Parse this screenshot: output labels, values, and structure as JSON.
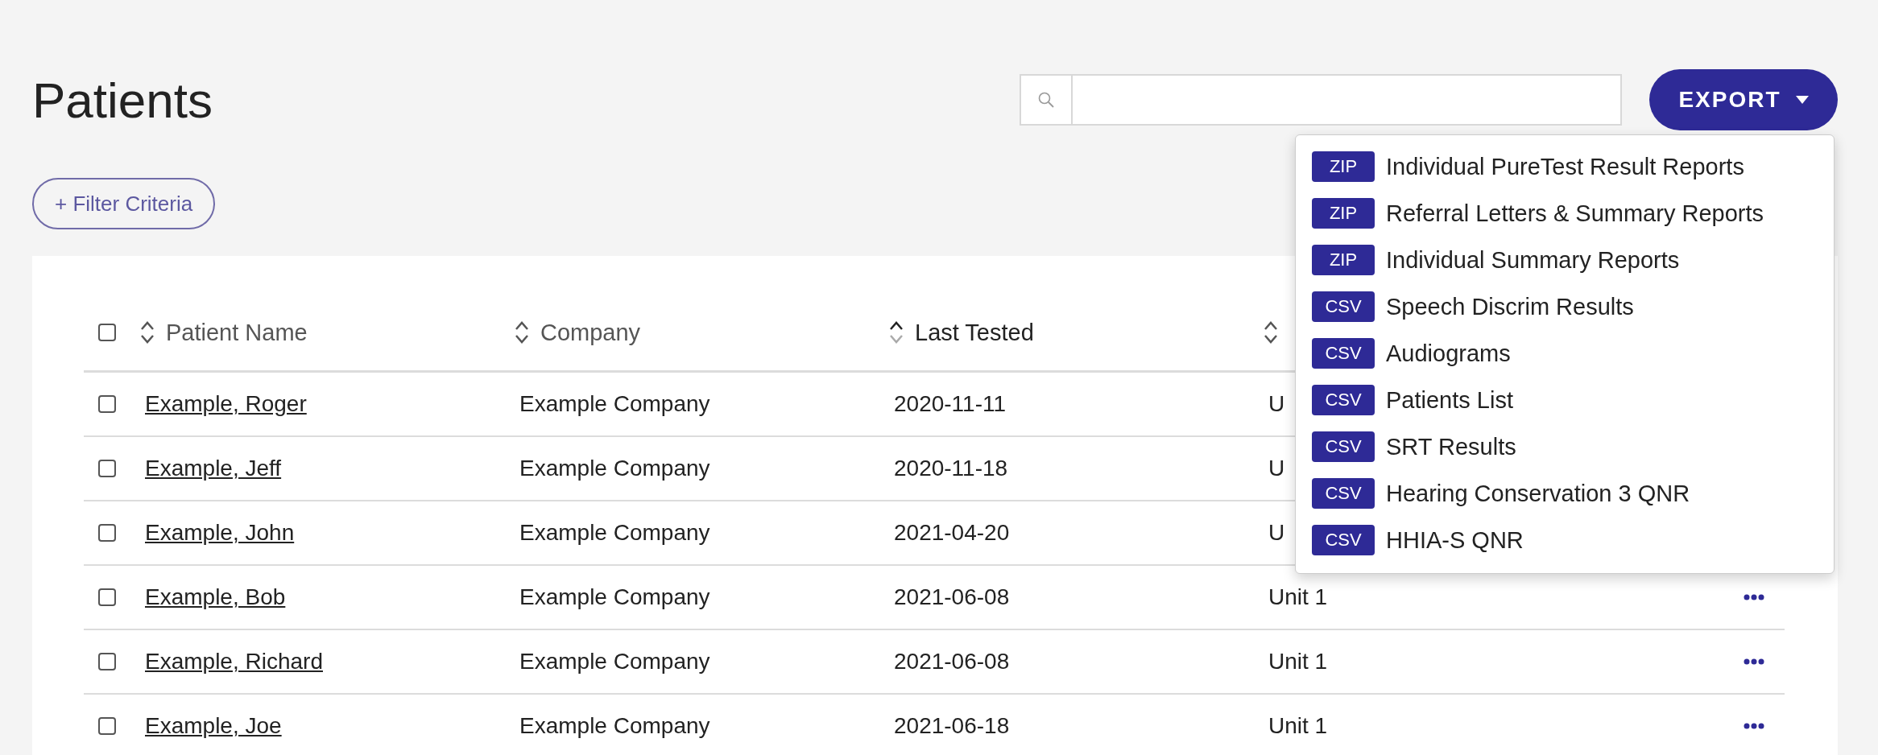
{
  "page": {
    "title": "Patients"
  },
  "export_button": {
    "label": "EXPORT",
    "expanded": true
  },
  "export_menu": [
    {
      "format": "ZIP",
      "label": "Individual PureTest Result Reports"
    },
    {
      "format": "ZIP",
      "label": "Referral Letters & Summary Reports"
    },
    {
      "format": "ZIP",
      "label": "Individual Summary Reports"
    },
    {
      "format": "CSV",
      "label": "Speech Discrim Results"
    },
    {
      "format": "CSV",
      "label": "Audiograms"
    },
    {
      "format": "CSV",
      "label": "Patients List"
    },
    {
      "format": "CSV",
      "label": "SRT Results"
    },
    {
      "format": "CSV",
      "label": "Hearing Conservation 3 QNR"
    },
    {
      "format": "CSV",
      "label": "HHIA-S QNR"
    }
  ],
  "filter_button": {
    "label": "+ Filter Criteria"
  },
  "table": {
    "select_all": {
      "checked": false
    },
    "columns": [
      {
        "label": "Patient Name",
        "sorted": false
      },
      {
        "label": "Company",
        "sorted": false
      },
      {
        "label": "Last Tested",
        "sorted": true
      },
      {
        "sorted": false
      }
    ],
    "rows": [
      {
        "checked": false,
        "patient_name": "Example, Roger",
        "company": "Example Company",
        "last_tested": "2020-11-11",
        "column_4": "U"
      },
      {
        "checked": false,
        "patient_name": "Example, Jeff",
        "company": "Example Company",
        "last_tested": "2020-11-18",
        "column_4": "U"
      },
      {
        "checked": false,
        "patient_name": "Example, John",
        "company": "Example Company",
        "last_tested": "2021-04-20",
        "column_4": "U"
      },
      {
        "checked": false,
        "patient_name": "Example, Bob",
        "company": "Example Company",
        "last_tested": "2021-06-08",
        "column_4": "Unit 1"
      },
      {
        "checked": false,
        "patient_name": "Example, Richard",
        "company": "Example Company",
        "last_tested": "2021-06-08",
        "column_4": "Unit 1"
      },
      {
        "checked": false,
        "patient_name": "Example, Joe",
        "company": "Example Company",
        "last_tested": "2021-06-18",
        "column_4": "Unit 1"
      }
    ]
  }
}
